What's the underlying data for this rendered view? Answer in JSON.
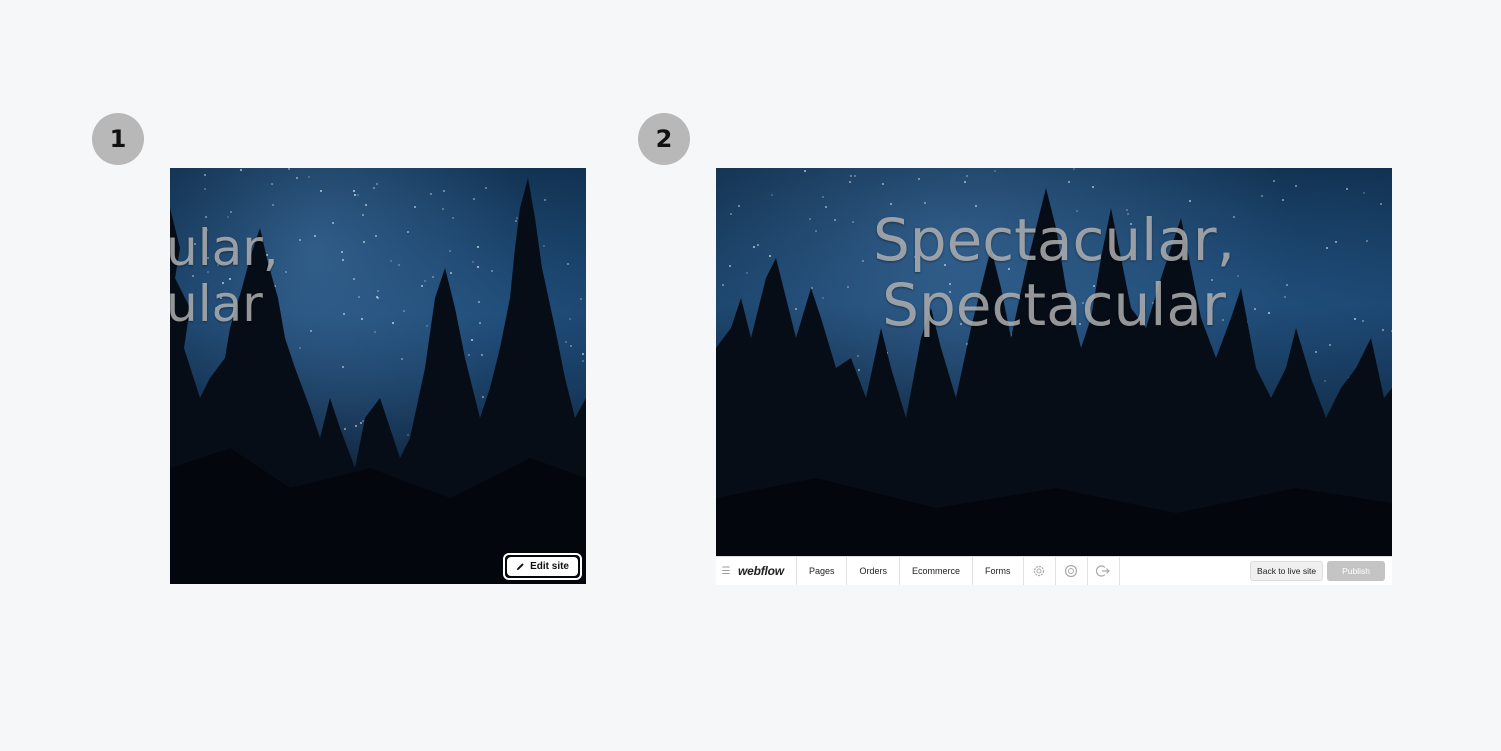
{
  "steps": [
    {
      "number": "1"
    },
    {
      "number": "2"
    }
  ],
  "panel1": {
    "hero_line1": "ular,",
    "hero_line2": "ular",
    "edit_site_label": "Edit site",
    "edit_icon": "pencil-icon"
  },
  "panel2": {
    "hero_line1": "Spectacular,",
    "hero_line2": "Spectacular"
  },
  "editor_bar": {
    "logo": "webflow",
    "menu_icon": "hamburger-icon",
    "items": [
      "Pages",
      "Orders",
      "Ecommerce",
      "Forms"
    ],
    "icons": [
      "gear-icon",
      "help-icon",
      "logout-icon"
    ],
    "back_to_live_label": "Back to live site",
    "publish_label": "Publish"
  },
  "colors": {
    "background": "#f6f7f8",
    "badge": "#b8b8b8",
    "sky": "#173f66",
    "publish_disabled": "#c4c4c4"
  }
}
